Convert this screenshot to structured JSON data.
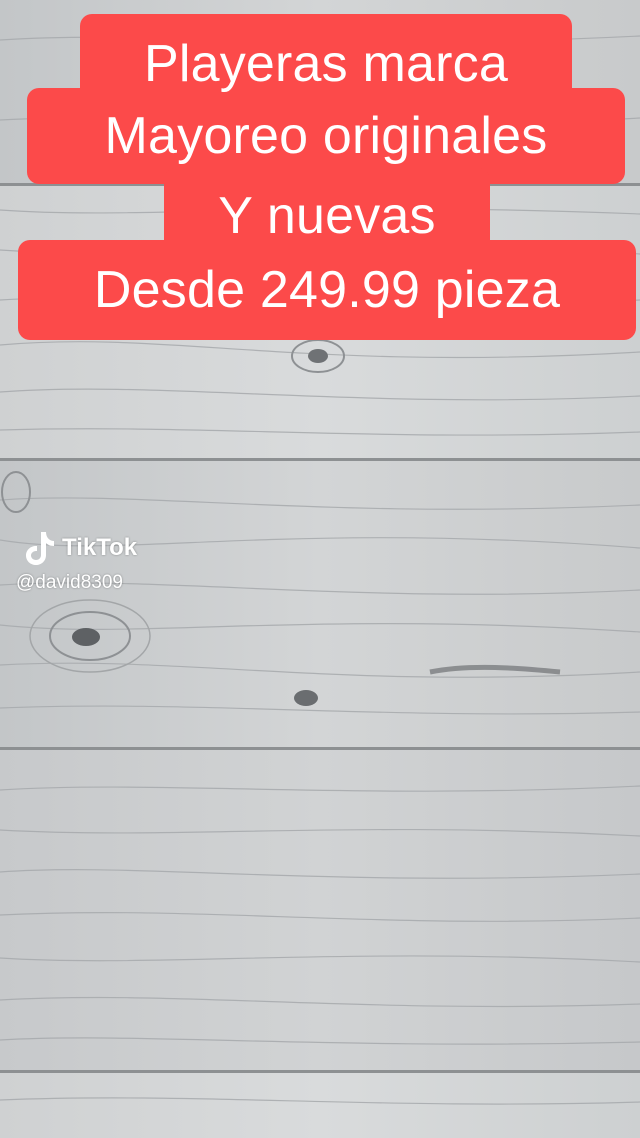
{
  "caption": {
    "line1": "Playeras marca",
    "line2": "Mayoreo originales",
    "line3": "Y nuevas",
    "line4": "Desde 249.99 pieza",
    "background_color": "#fc4a4a",
    "text_color": "#ffffff"
  },
  "watermark": {
    "icon": "tiktok-note-icon",
    "brand": "TikTok",
    "handle": "@david8309"
  },
  "background": {
    "description_icon": "whitewashed-wood-planks"
  }
}
